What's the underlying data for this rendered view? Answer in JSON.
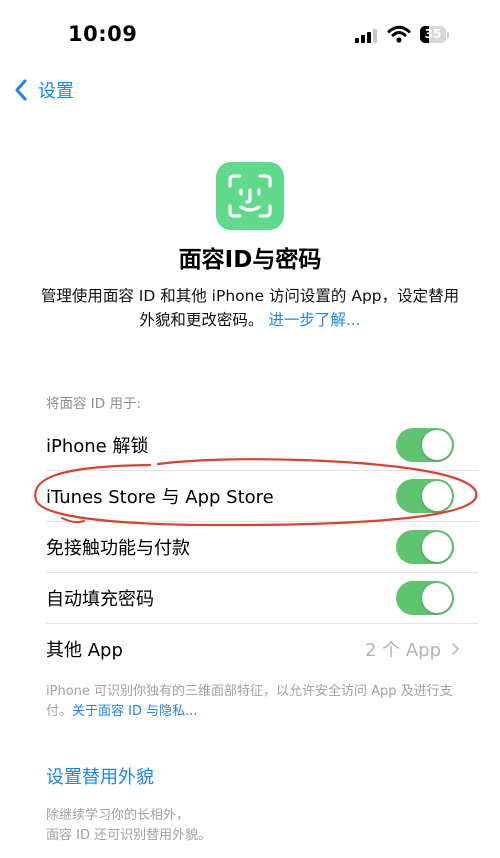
{
  "status_bar": {
    "time": "10:09",
    "battery": "35",
    "battery_fill_fraction": 0.35
  },
  "nav": {
    "back_label": "设置"
  },
  "header": {
    "icon": "face-id-icon",
    "icon_color": "#5fd98a",
    "title": "面容ID与密码",
    "description": "管理使用面容 ID 和其他 iPhone 访问设置的 App，设定替用外貌和更改密码。",
    "learn_more": "进一步了解..."
  },
  "section": {
    "label": "将面容 ID 用于:",
    "items": [
      {
        "label": "iPhone 解锁",
        "enabled": true
      },
      {
        "label": "iTunes Store 与 App Store",
        "enabled": true
      },
      {
        "label": "免接触功能与付款",
        "enabled": true
      },
      {
        "label": "自动填充密码",
        "enabled": true
      }
    ],
    "other_apps": {
      "label": "其他 App",
      "value": "2 个 App"
    },
    "footnote": "iPhone 可识别你独有的三维面部特征，以允许安全访问 App 及进行支付。",
    "footnote_link": "关于面容 ID 与隐私..."
  },
  "alternate": {
    "link": "设置替用外貌",
    "footnote_line1": "除继续学习你的长相外，",
    "footnote_line2": "面容 ID 还可识别替用外貌。"
  },
  "colors": {
    "accent": "#1a87f0",
    "toggle_on": "#5fc36f",
    "annotation": "#d9412e"
  }
}
